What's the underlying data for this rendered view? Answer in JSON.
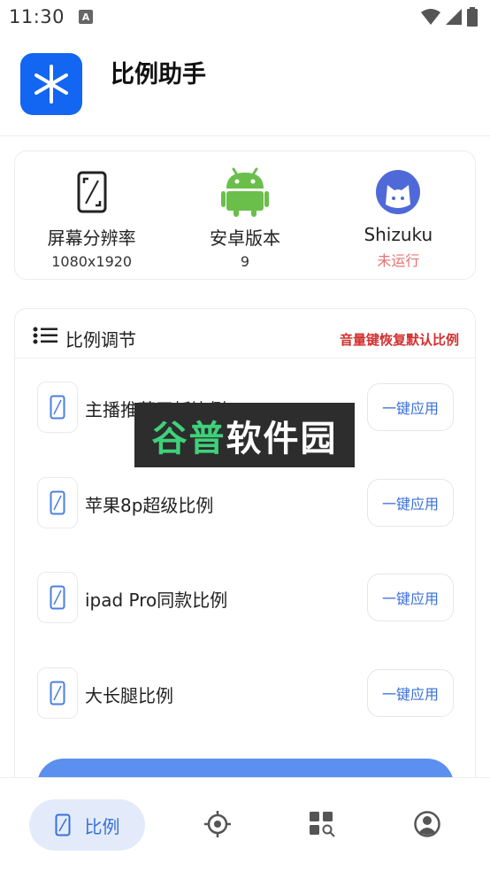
{
  "status_bar": {
    "time": "11:30",
    "notification_icon": "A",
    "icons": [
      "a-notification-icon",
      "wifi-icon",
      "signal-icon",
      "battery-icon"
    ]
  },
  "app": {
    "title": "比例助手",
    "logo_icon": "asterisk-logo-icon",
    "accent_color": "#1266f1"
  },
  "info": [
    {
      "icon": "phone-resolution-icon",
      "label": "屏幕分辨率",
      "value": "1080x1920"
    },
    {
      "icon": "android-icon",
      "label": "安卓版本",
      "value": "9"
    },
    {
      "icon": "shizuku-icon",
      "label": "Shizuku",
      "value": "未运行",
      "value_color": "#e57373"
    }
  ],
  "ratio_section": {
    "icon": "list-icon",
    "title": "比例调节",
    "hint": "音量键恢复默认比例",
    "hint_color": "#d32f2f",
    "items": [
      {
        "name": "主播推荐平板比例",
        "button": "一键应用",
        "icon": "phone-icon"
      },
      {
        "name": "苹果8p超级比例",
        "button": "一键应用",
        "icon": "phone-icon"
      },
      {
        "name": "ipad Pro同款比例",
        "button": "一键应用",
        "icon": "phone-icon"
      },
      {
        "name": "大长腿比例",
        "button": "一键应用",
        "icon": "phone-icon"
      }
    ]
  },
  "watermark": {
    "part1": "谷普",
    "part2": "软件园"
  },
  "bottom_nav": {
    "items": [
      {
        "label": "比例",
        "icon": "phone-ratio-icon",
        "active": true
      },
      {
        "label": "",
        "icon": "crosshair-icon",
        "active": false
      },
      {
        "label": "",
        "icon": "grid-search-icon",
        "active": false
      },
      {
        "label": "",
        "icon": "profile-icon",
        "active": false
      }
    ],
    "active_color": "#3a6fd8"
  }
}
